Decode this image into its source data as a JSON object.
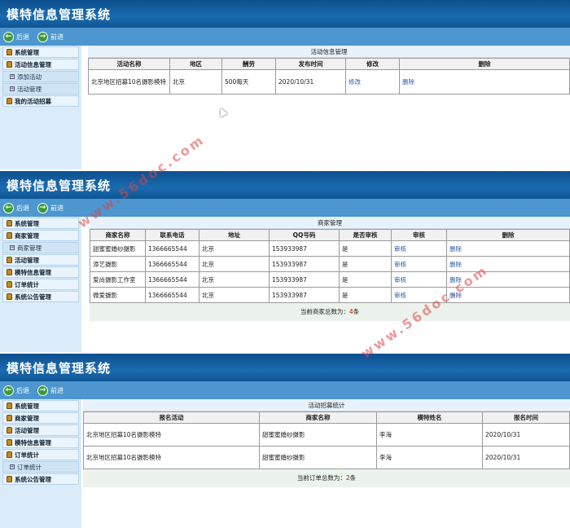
{
  "app_title": "模特信息管理系统",
  "nav": {
    "back": "后退",
    "forward": "前进"
  },
  "watermark": "www.56doc.com",
  "panel1": {
    "sidebar": [
      {
        "label": "系统管理",
        "type": "group"
      },
      {
        "label": "活动信息管理",
        "type": "group"
      },
      {
        "label": "添加活动",
        "type": "sub"
      },
      {
        "label": "活动管理",
        "type": "sub"
      },
      {
        "label": "我的活动招募",
        "type": "group"
      }
    ],
    "title": "活动信息管理",
    "headers": [
      "活动名称",
      "地区",
      "酬劳",
      "发布时间",
      "修改",
      "删除"
    ],
    "rows": [
      [
        "北京地区招募10名摄影模特",
        "北京",
        "500每天",
        "2020/10/31",
        "修改",
        "删除"
      ]
    ]
  },
  "panel2": {
    "sidebar": [
      {
        "label": "系统管理",
        "type": "group"
      },
      {
        "label": "商家管理",
        "type": "group"
      },
      {
        "label": "商家管理",
        "type": "sub"
      },
      {
        "label": "活动管理",
        "type": "group"
      },
      {
        "label": "模特信息管理",
        "type": "group"
      },
      {
        "label": "订单统计",
        "type": "group"
      },
      {
        "label": "系统公告管理",
        "type": "group"
      }
    ],
    "title": "商家管理",
    "headers": [
      "商家名称",
      "联系电话",
      "地址",
      "QQ号码",
      "是否审核",
      "审核",
      "删除"
    ],
    "rows": [
      [
        "甜蜜蜜婚纱摄影",
        "1366665544",
        "北京",
        "153933987",
        "是",
        "审核",
        "删除"
      ],
      [
        "添艺摄影",
        "1366665544",
        "北京",
        "153933987",
        "是",
        "审核",
        "删除"
      ],
      [
        "爱尚摄影工作室",
        "1366665544",
        "北京",
        "153933987",
        "是",
        "审核",
        "删除"
      ],
      [
        "微爱摄影",
        "1366665544",
        "北京",
        "153933987",
        "是",
        "审核",
        "删除"
      ]
    ],
    "footer_prefix": "当前商家总数为：",
    "footer_count": "4",
    "footer_suffix": "条"
  },
  "panel3": {
    "sidebar": [
      {
        "label": "系统管理",
        "type": "group"
      },
      {
        "label": "商家管理",
        "type": "group"
      },
      {
        "label": "活动管理",
        "type": "group"
      },
      {
        "label": "模特信息管理",
        "type": "group"
      },
      {
        "label": "订单统计",
        "type": "group"
      },
      {
        "label": "订单统计",
        "type": "sub"
      },
      {
        "label": "系统公告管理",
        "type": "group"
      }
    ],
    "title": "活动招募统计",
    "headers": [
      "报名活动",
      "商家名称",
      "模特姓名",
      "报名时间"
    ],
    "rows": [
      [
        "北京地区招募10名摄影模特",
        "甜蜜蜜婚纱摄影",
        "李海",
        "2020/10/31"
      ],
      [
        "北京地区招募10名摄影模特",
        "甜蜜蜜婚纱摄影",
        "李海",
        "2020/10/31"
      ]
    ],
    "footer_prefix": "当前订单总数为：",
    "footer_count": "2",
    "footer_suffix": "条"
  }
}
